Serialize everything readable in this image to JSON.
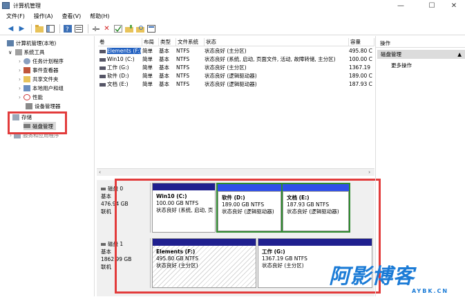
{
  "window": {
    "title": "计算机管理"
  },
  "menu": [
    "文件(F)",
    "操作(A)",
    "查看(V)",
    "帮助(H)"
  ],
  "tree": {
    "root": "计算机管理(本地)",
    "system_tools": "系统工具",
    "task_scheduler": "任务计划程序",
    "event_viewer": "事件查看器",
    "shared_folders": "共享文件夹",
    "local_users": "本地用户和组",
    "performance": "性能",
    "device_manager": "设备管理器",
    "storage": "存储",
    "disk_management": "磁盘管理",
    "services": "服务和应用程序"
  },
  "columns": [
    "卷",
    "布局",
    "类型",
    "文件系统",
    "状态",
    "容量"
  ],
  "volumes": [
    {
      "name": "Elements (F:)",
      "layout": "简单",
      "type": "基本",
      "fs": "NTFS",
      "status": "状态良好 (主分区)",
      "capacity": "495.80 C",
      "selected": true
    },
    {
      "name": "Win10 (C:)",
      "layout": "简单",
      "type": "基本",
      "fs": "NTFS",
      "status": "状态良好 (系统, 启动, 页面文件, 活动, 故障转储, 主分区)",
      "capacity": "100.00 C",
      "selected": false
    },
    {
      "name": "工作 (G:)",
      "layout": "简单",
      "type": "基本",
      "fs": "NTFS",
      "status": "状态良好 (主分区)",
      "capacity": "1367.19",
      "selected": false
    },
    {
      "name": "软件 (D:)",
      "layout": "简单",
      "type": "基本",
      "fs": "NTFS",
      "status": "状态良好 (逻辑驱动器)",
      "capacity": "189.00 C",
      "selected": false
    },
    {
      "name": "文档 (E:)",
      "layout": "简单",
      "type": "基本",
      "fs": "NTFS",
      "status": "状态良好 (逻辑驱动器)",
      "capacity": "187.93 C",
      "selected": false
    }
  ],
  "disks": [
    {
      "title": "磁盘 0",
      "kind": "基本",
      "size": "476.94 GB",
      "state": "联机",
      "partitions": [
        {
          "name": "Win10  (C:)",
          "size": "100.00 GB NTFS",
          "status": "状态良好 (系统, 启动, 页"
        },
        {
          "name": "软件  (D:)",
          "size": "189.00 GB NTFS",
          "status": "状态良好 (逻辑驱动器)"
        },
        {
          "name": "文档  (E:)",
          "size": "187.93 GB NTFS",
          "status": "状态良好 (逻辑驱动器)"
        }
      ]
    },
    {
      "title": "磁盘 1",
      "kind": "基本",
      "size": "1862.99 GB",
      "state": "联机",
      "partitions": [
        {
          "name": "Elements  (F:)",
          "size": "495.80 GB NTFS",
          "status": "状态良好 (主分区)"
        },
        {
          "name": "工作  (G:)",
          "size": "1367.19 GB NTFS",
          "status": "状态良好 (主分区)"
        }
      ]
    }
  ],
  "actions": {
    "header": "操作",
    "selected": "磁盘管理",
    "more": "更多操作"
  },
  "watermark": {
    "main": "阿影博客",
    "sub": "AYBK.CN"
  },
  "colors": {
    "primary_bar": "#1f1f8f",
    "logical_bar": "#2f4fe8",
    "highlight_red": "#e23b3b",
    "logical_frame_green": "#2e8b2e",
    "watermark_blue": "#1b7bd6"
  }
}
